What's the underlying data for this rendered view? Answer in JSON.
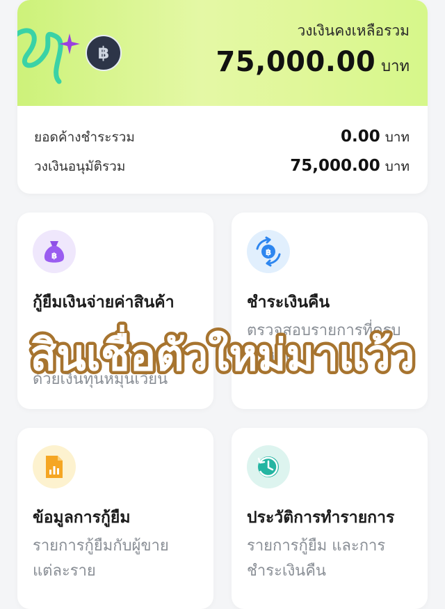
{
  "summary": {
    "credit_remaining_label": "วงเงินคงเหลือรวม",
    "credit_remaining_value": "75,000.00",
    "unit": "บาท",
    "outstanding_label": "ยอดค้างชำระรวม",
    "outstanding_value": "0.00",
    "approved_label": "วงเงินอนุมัติรวม",
    "approved_value": "75,000.00",
    "coin_symbol": "฿"
  },
  "cards": [
    {
      "title": "กู้ยืมเงินจ่ายค่าสินค้า",
      "desc": "ด้วยเงินทุนหมุนเวียน",
      "icon": "money-bag-icon",
      "icon_bg": "#efe7fc"
    },
    {
      "title": "ชำระเงินคืน",
      "desc": "ตรวจสอบรายการที่ครบกำหนด",
      "icon": "repay-cycle-icon",
      "icon_bg": "#e1effd"
    },
    {
      "title": "ข้อมูลการกู้ยืม",
      "desc": "รายการกู้ยืมกับผู้ขายแต่ละราย",
      "icon": "report-icon",
      "icon_bg": "#fdf2cf"
    },
    {
      "title": "ประวัติการทำรายการ",
      "desc": "รายการกู้ยืม และการชำระเงินคืน",
      "icon": "history-icon",
      "icon_bg": "#ddf4ef"
    }
  ],
  "overlay_text": "สินเชื่อตัวใหม่มาแว้ว",
  "colors": {
    "accent_green": "#d6f78a",
    "overlay_fill": "#ffffff",
    "overlay_stroke": "#a7742f"
  }
}
